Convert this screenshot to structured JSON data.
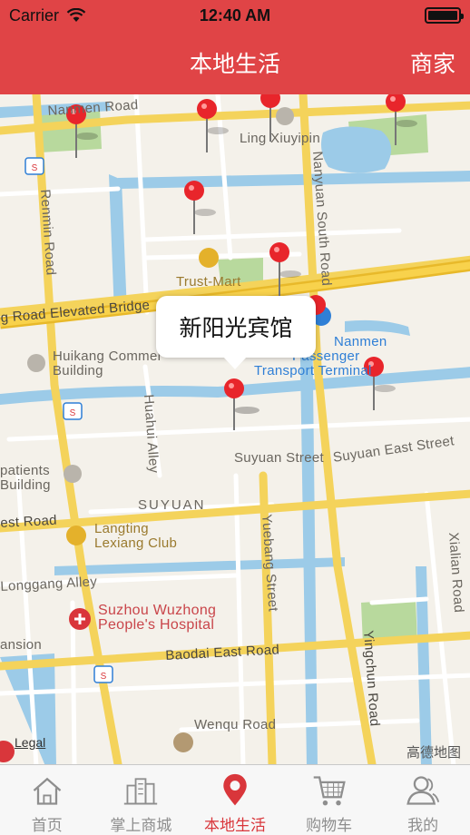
{
  "status_bar": {
    "carrier": "Carrier",
    "time": "12:40 AM"
  },
  "nav": {
    "title": "本地生活",
    "right_button": "商家"
  },
  "map": {
    "labels": {
      "nanmen_road": "Nanmen Road",
      "ling_xiuyipin": "Ling Xiuyipin",
      "renmin_road": "Renmin Road",
      "nanyuan_south_road": "Nanyuan South Road",
      "trust_mart": "Trust-Mart",
      "elevated_bridge": "g Road Elevated Bridge",
      "huikang": "Huikang Commer",
      "huikang_building": "Building",
      "nanmen": "Nanmen",
      "passenger": "Passenger",
      "transport_terminal": "Transport Terminal",
      "huahui_alley": "Huahui Alley",
      "suyuan_street": "Suyuan Street",
      "suyuan_east_street": "Suyuan East Street",
      "outpatients": "patients",
      "outpatients_building": "Building",
      "suyuan": "SUYUAN",
      "est_road": "est Road",
      "langting": "Langting",
      "lexiang_club": "Lexiang Club",
      "longgang_alley": "Longgang Alley",
      "hospital_1": "Suzhou Wuzhong",
      "hospital_2": "People's Hospital",
      "ansion": "ansion",
      "baodai_east_road": "Baodai East Road",
      "yuebang_street": "Yuebang Street",
      "yingchun_road": "Yingchun Road",
      "xialian_road": "Xialian Road",
      "wenqu_road": "Wenqu Road",
      "legal": "Legal",
      "provider": "高德地图"
    },
    "callout": "新阳光宾馆",
    "pin_color": "#e8252b"
  },
  "tabs": [
    {
      "label": "首页",
      "icon": "home-icon"
    },
    {
      "label": "掌上商城",
      "icon": "shop-icon"
    },
    {
      "label": "本地生活",
      "icon": "location-pin-icon",
      "active": true
    },
    {
      "label": "购物车",
      "icon": "cart-icon"
    },
    {
      "label": "我的",
      "icon": "user-icon"
    }
  ]
}
